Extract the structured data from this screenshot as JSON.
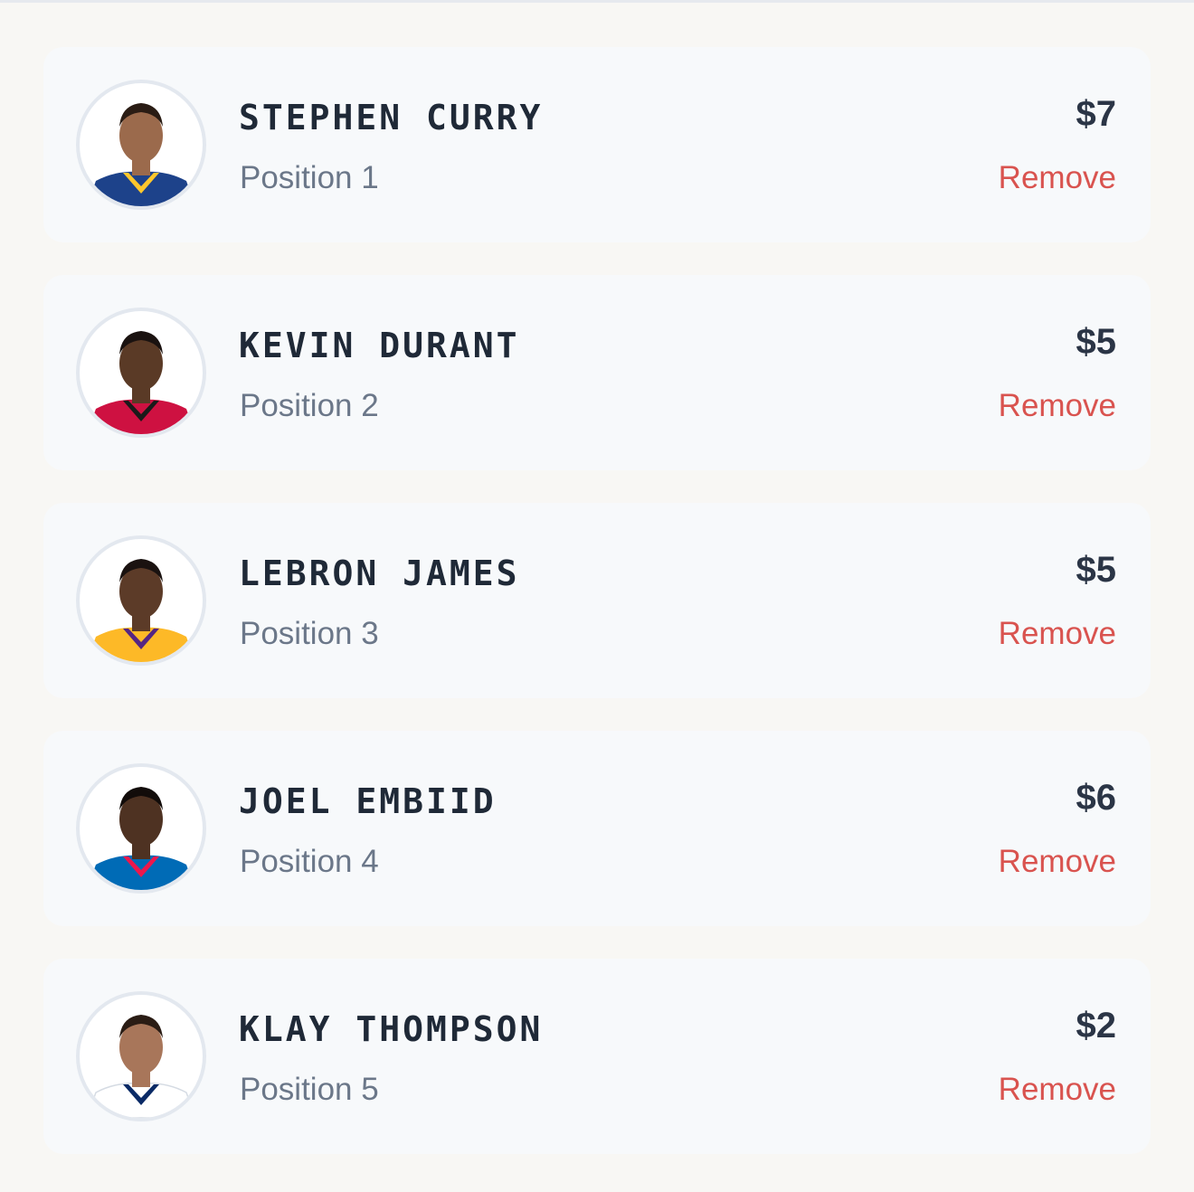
{
  "players": [
    {
      "name": "STEPHEN CURRY",
      "position": "Position 1",
      "price": "$7",
      "remove_label": "Remove",
      "jersey_color": "#1d428a",
      "trim_color": "#ffc72c",
      "skin_color": "#9b6a4c",
      "hair_color": "#2a1c14"
    },
    {
      "name": "KEVIN DURANT",
      "position": "Position 2",
      "price": "$5",
      "remove_label": "Remove",
      "jersey_color": "#ce1141",
      "trim_color": "#1a1a1a",
      "skin_color": "#5a3a26",
      "hair_color": "#1a1210"
    },
    {
      "name": "LEBRON JAMES",
      "position": "Position 3",
      "price": "$5",
      "remove_label": "Remove",
      "jersey_color": "#fdb927",
      "trim_color": "#552583",
      "skin_color": "#5c3b28",
      "hair_color": "#1a1210"
    },
    {
      "name": "JOEL EMBIID",
      "position": "Position 4",
      "price": "$6",
      "remove_label": "Remove",
      "jersey_color": "#006bb6",
      "trim_color": "#ed174c",
      "skin_color": "#4e3222",
      "hair_color": "#120c0a"
    },
    {
      "name": "KLAY THOMPSON",
      "position": "Position 5",
      "price": "$2",
      "remove_label": "Remove",
      "jersey_color": "#ffffff",
      "trim_color": "#0a2a66",
      "skin_color": "#a8765a",
      "hair_color": "#2a1c14"
    }
  ]
}
